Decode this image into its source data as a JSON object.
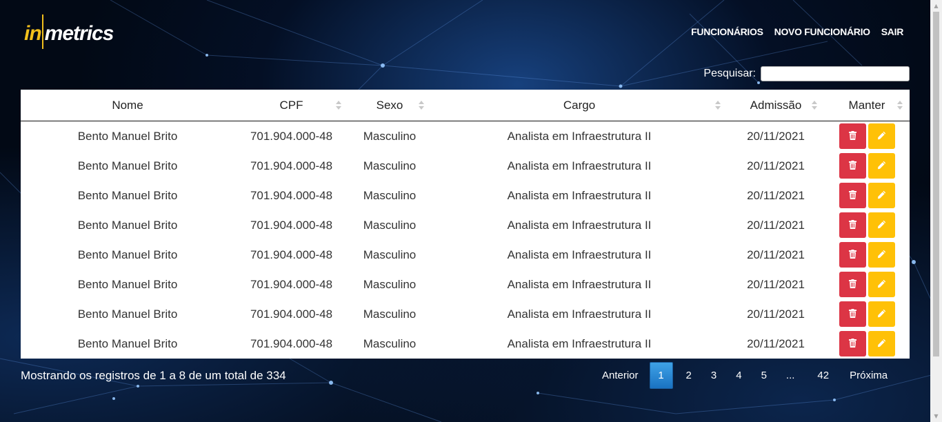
{
  "brand": {
    "logo_in": "in",
    "logo_metrics": "metrics"
  },
  "nav": {
    "items": [
      "FUNCIONÁRIOS",
      "NOVO FUNCIONÁRIO",
      "SAIR"
    ]
  },
  "search": {
    "label": "Pesquisar:",
    "value": ""
  },
  "table": {
    "columns": [
      "Nome",
      "CPF",
      "Sexo",
      "Cargo",
      "Admissão",
      "Manter"
    ],
    "rows": [
      {
        "nome": "Bento Manuel Brito",
        "cpf": "701.904.000-48",
        "sexo": "Masculino",
        "cargo": "Analista em Infraestrutura II",
        "admissao": "20/11/2021"
      },
      {
        "nome": "Bento Manuel Brito",
        "cpf": "701.904.000-48",
        "sexo": "Masculino",
        "cargo": "Analista em Infraestrutura II",
        "admissao": "20/11/2021"
      },
      {
        "nome": "Bento Manuel Brito",
        "cpf": "701.904.000-48",
        "sexo": "Masculino",
        "cargo": "Analista em Infraestrutura II",
        "admissao": "20/11/2021"
      },
      {
        "nome": "Bento Manuel Brito",
        "cpf": "701.904.000-48",
        "sexo": "Masculino",
        "cargo": "Analista em Infraestrutura II",
        "admissao": "20/11/2021"
      },
      {
        "nome": "Bento Manuel Brito",
        "cpf": "701.904.000-48",
        "sexo": "Masculino",
        "cargo": "Analista em Infraestrutura II",
        "admissao": "20/11/2021"
      },
      {
        "nome": "Bento Manuel Brito",
        "cpf": "701.904.000-48",
        "sexo": "Masculino",
        "cargo": "Analista em Infraestrutura II",
        "admissao": "20/11/2021"
      },
      {
        "nome": "Bento Manuel Brito",
        "cpf": "701.904.000-48",
        "sexo": "Masculino",
        "cargo": "Analista em Infraestrutura II",
        "admissao": "20/11/2021"
      },
      {
        "nome": "Bento Manuel Brito",
        "cpf": "701.904.000-48",
        "sexo": "Masculino",
        "cargo": "Analista em Infraestrutura II",
        "admissao": "20/11/2021"
      }
    ],
    "actions": {
      "delete_icon": "trash-icon",
      "edit_icon": "pencil-icon"
    }
  },
  "footer": {
    "info": "Mostrando os registros de 1 a 8 de um total de 334",
    "pagination": {
      "prev": "Anterior",
      "pages": [
        "1",
        "2",
        "3",
        "4",
        "5",
        "...",
        "42"
      ],
      "active": "1",
      "next": "Próxima"
    }
  },
  "colors": {
    "accent_yellow": "#ffc107",
    "danger_red": "#dc3545",
    "active_page_blue": "#2b8ad6",
    "logo_yellow": "#f2c01c"
  }
}
